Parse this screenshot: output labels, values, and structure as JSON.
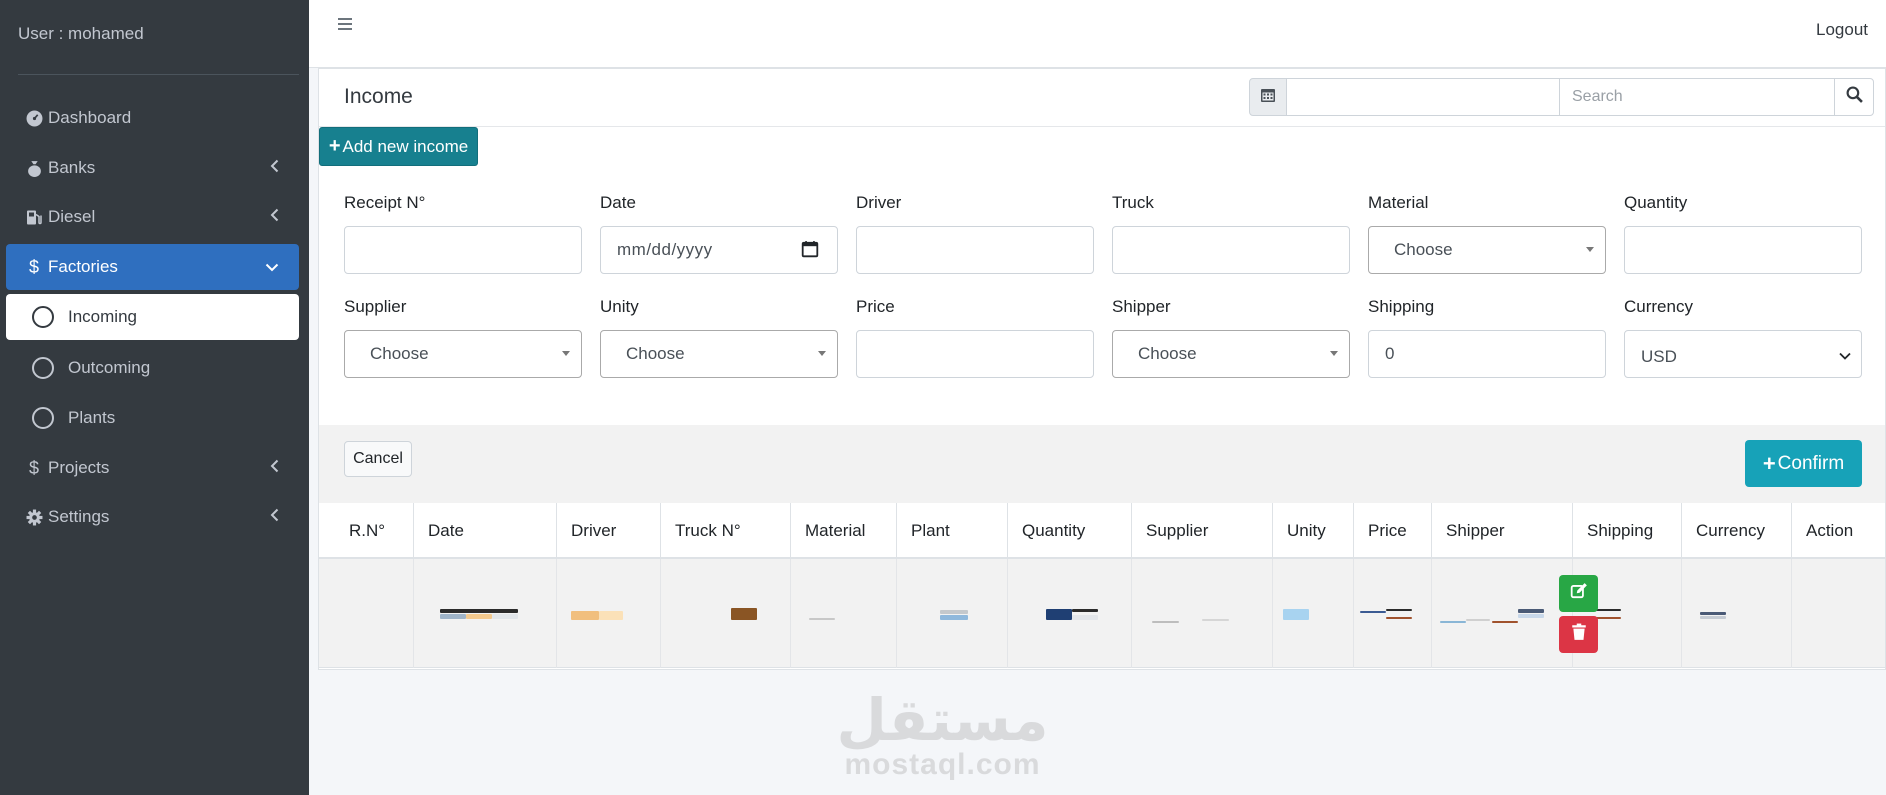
{
  "sidebar": {
    "user": "User : mohamed",
    "items": [
      {
        "label": "Dashboard",
        "icon": "tachometer-icon"
      },
      {
        "label": "Banks",
        "icon": "money-bag-icon"
      },
      {
        "label": "Diesel",
        "icon": "gas-pump-icon"
      },
      {
        "label": "Factories",
        "icon": "dollar-icon"
      },
      {
        "label": "Projects",
        "icon": "dollar-icon"
      },
      {
        "label": "Settings",
        "icon": "gear-icon"
      }
    ],
    "sub_items": [
      "Incoming",
      "Outcoming",
      "Plants"
    ]
  },
  "topbar": {
    "logout": "Logout"
  },
  "card": {
    "title": "Income",
    "search_placeholder": "Search",
    "add_label": "Add new income"
  },
  "form": {
    "labels": {
      "receipt": "Receipt N°",
      "date": "Date",
      "driver": "Driver",
      "truck": "Truck",
      "material": "Material",
      "quantity": "Quantity",
      "supplier": "Supplier",
      "unity": "Unity",
      "price": "Price",
      "shipper": "Shipper",
      "shipping": "Shipping",
      "currency": "Currency"
    },
    "values": {
      "date_placeholder": "mm/dd/yyyy",
      "material": "Choose",
      "supplier": "Choose",
      "unity": "Choose",
      "shipper": "Choose",
      "shipping": "0",
      "currency": "USD"
    },
    "cancel": "Cancel",
    "confirm": "Confirm"
  },
  "table": {
    "columns": [
      "R.N°",
      "Date",
      "Driver",
      "Truck N°",
      "Material",
      "Plant",
      "Quantity",
      "Supplier",
      "Unity",
      "Price",
      "Shipper",
      "Shipping",
      "Currency",
      "Action"
    ]
  },
  "watermark": {
    "arabic": "مستقل",
    "latin": "mostaql.com"
  },
  "colors": {
    "sidebar": "#343a40",
    "active": "#2f6fbf",
    "add": "#17808f",
    "confirm": "#17a2b8",
    "edit": "#28a745",
    "delete": "#dc3545"
  }
}
